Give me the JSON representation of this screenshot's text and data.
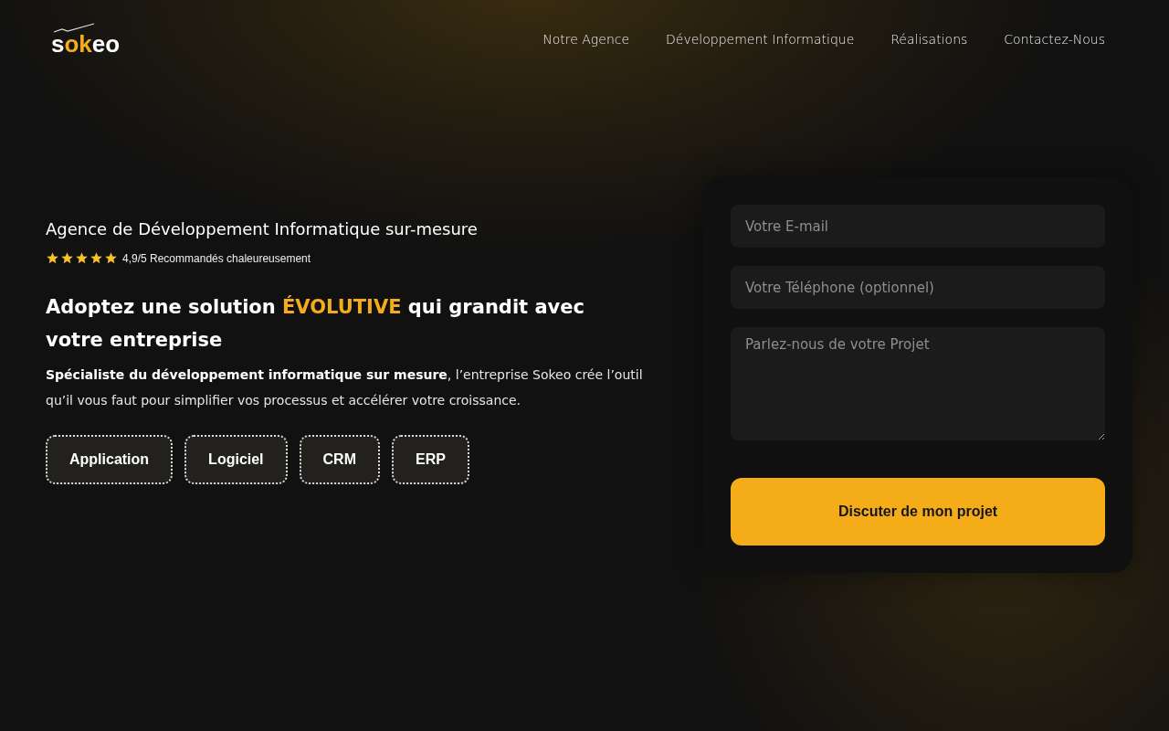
{
  "logo": [
    {
      "text": "s",
      "accent": false
    },
    {
      "text": "ok",
      "accent": true
    },
    {
      "text": "eo",
      "accent": false
    }
  ],
  "nav": [
    {
      "label": "Notre Agence"
    },
    {
      "label": "Développement Informatique"
    },
    {
      "label": "Réalisations"
    },
    {
      "label": "Contactez-Nous"
    }
  ],
  "hero": {
    "eyebrow": "Agence de Développement Informatique sur-mesure",
    "rating": {
      "stars": 5,
      "text": "4,9/5 Recommandés chaleureusement"
    },
    "headline": [
      {
        "text": "Adoptez une solution ",
        "accent": false
      },
      {
        "text": "ÉVOLUTIVE",
        "accent": true
      },
      {
        "text": " qui grandit avec votre entreprise",
        "accent": false
      }
    ],
    "description": "**Spécialiste du développement informatique sur mesure**, l’entreprise Sokeo crée l’outil qu’il vous faut pour simplifier vos processus et accélérer votre croissance.",
    "tags": [
      "Application",
      "Logiciel",
      "CRM",
      "ERP"
    ]
  },
  "form": {
    "fields": [
      {
        "kind": "input",
        "placeholder": "Votre E-mail"
      },
      {
        "kind": "input",
        "placeholder": "Votre Téléphone (optionnel)"
      },
      {
        "kind": "textarea",
        "placeholder": "Parlez-nous de votre Projet"
      }
    ],
    "submit": "Discuter de mon projet"
  }
}
